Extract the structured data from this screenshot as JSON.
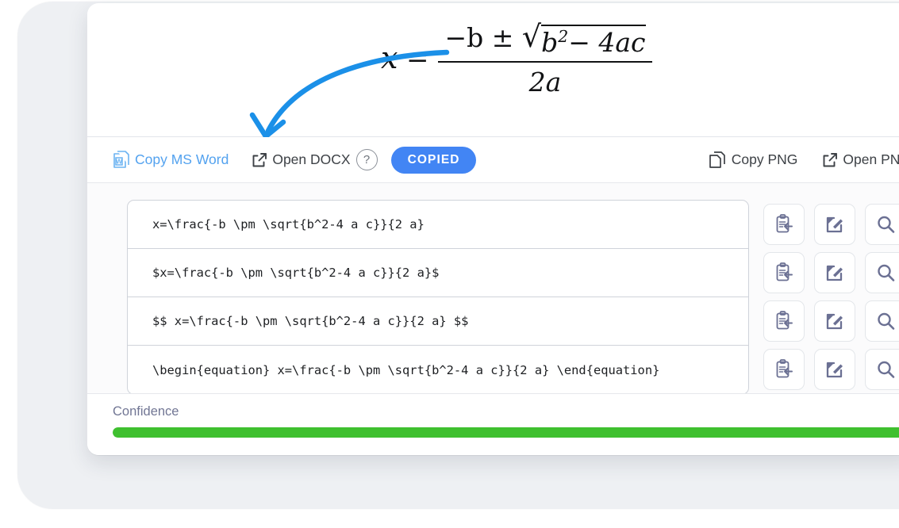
{
  "equation": {
    "alt": "x = (-b ± sqrt(b^2 - 4ac)) / (2a)",
    "lhs_var": "x",
    "equals": "=",
    "numerator_lead": "−b ±",
    "radical": "√",
    "radicand_base": "b",
    "radicand_sup": "2",
    "radicand_tail": "− 4ac",
    "denominator": "2a"
  },
  "annotation": {
    "type": "curved-arrow",
    "color": "#1b90e8",
    "points_to": "Copy MS Word"
  },
  "toolbar": {
    "copy_ms_word": "Copy MS Word",
    "open_docx": "Open DOCX",
    "help": "?",
    "copied_badge": "COPIED",
    "copy_png": "Copy PNG",
    "open_png": "Open PNG",
    "icons": {
      "word": "word-document-icon",
      "external_docx": "external-link-icon",
      "help": "help-circle-icon",
      "copy_png": "copy-pages-icon",
      "external_png": "external-link-icon"
    },
    "colors": {
      "link_blue": "#53a2ef",
      "badge_blue": "#4285f4",
      "text_dark": "#3d4146"
    }
  },
  "latex_rows": [
    {
      "value": "x=\\frac{-b \\pm \\sqrt{b^2-4 a c}}{2 a}",
      "actions": [
        "paste-clipboard-icon",
        "edit-square-icon",
        "magnifier-icon"
      ]
    },
    {
      "value": "$x=\\frac{-b \\pm \\sqrt{b^2-4 a c}}{2 a}$",
      "actions": [
        "paste-clipboard-icon",
        "edit-square-icon",
        "magnifier-icon"
      ]
    },
    {
      "value": "$$ x=\\frac{-b \\pm \\sqrt{b^2-4 a c}}{2 a} $$",
      "actions": [
        "paste-clipboard-icon",
        "edit-square-icon",
        "magnifier-icon"
      ]
    },
    {
      "value": "\\begin{equation} x=\\frac{-b \\pm \\sqrt{b^2-4 a c}}{2 a} \\end{equation}",
      "actions": [
        "paste-clipboard-icon",
        "edit-square-icon",
        "magnifier-icon"
      ]
    }
  ],
  "confidence": {
    "label": "Confidence",
    "percent": 100,
    "fill_color": "#3fc02f"
  }
}
